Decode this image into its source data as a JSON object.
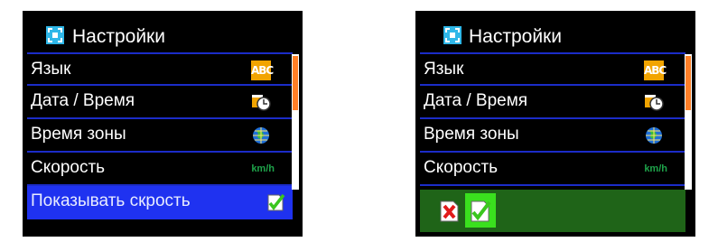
{
  "left_screen": {
    "title": "Настройки",
    "items": [
      {
        "label": "Язык",
        "icon": "abc-language-icon",
        "icon_text": "ABC"
      },
      {
        "label": "Дата / Время",
        "icon": "calendar-clock-icon"
      },
      {
        "label": "Время зоны",
        "icon": "globe-icon"
      },
      {
        "label": "Скорость",
        "icon": "kmh-icon",
        "icon_text": "km/h"
      },
      {
        "label": "Показывать скрость",
        "icon": "checkbox-check-icon",
        "selected": true
      }
    ]
  },
  "right_screen": {
    "title": "Настройки",
    "items": [
      {
        "label": "Язык",
        "icon": "abc-language-icon",
        "icon_text": "ABC"
      },
      {
        "label": "Дата / Время",
        "icon": "calendar-clock-icon"
      },
      {
        "label": "Время зоны",
        "icon": "globe-icon"
      },
      {
        "label": "Скорость",
        "icon": "kmh-icon",
        "icon_text": "km/h"
      }
    ],
    "confirm_bar": {
      "cancel_icon": "red-x-icon",
      "confirm_icon": "green-check-icon"
    }
  },
  "colors": {
    "background": "#000000",
    "divider": "#1b2cc8",
    "selected": "#1f32f0",
    "scrollbar_thumb": "#ff7f27",
    "confirm_bar": "#1f6418",
    "confirm_active": "#3ae01e"
  }
}
